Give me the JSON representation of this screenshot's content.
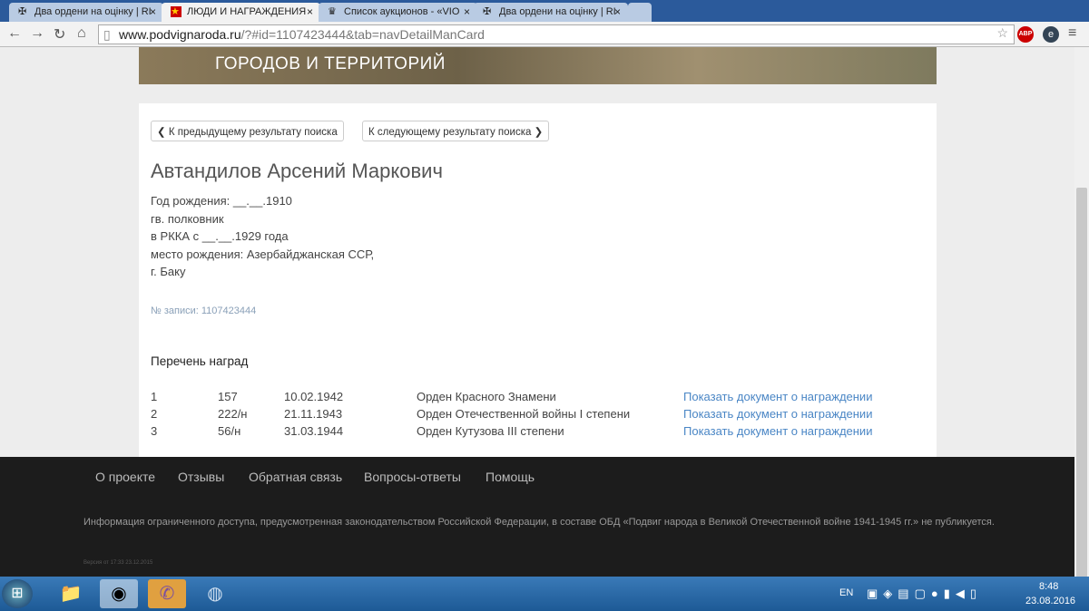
{
  "browser": {
    "tabs": [
      {
        "title": "Два ордени на оцінку | RI",
        "icon": "cross-icon",
        "active": false
      },
      {
        "title": "ЛЮДИ И НАГРАЖДЕНИЯ",
        "icon": "site-icon",
        "active": true
      },
      {
        "title": "Список аукционов - «VIO",
        "icon": "crown-icon",
        "active": false
      },
      {
        "title": "Два ордени на оцінку | RI",
        "icon": "cross-icon",
        "active": false
      }
    ],
    "url_host": "www.podvignaroda.ru",
    "url_rest": "/?#id=1107423444&tab=navDetailManCard"
  },
  "banner": {
    "text": "ГОРОДОВ И ТЕРРИТОРИЙ"
  },
  "card": {
    "prev": "К предыдущему результату поиска",
    "next": "К следующему результату поиска",
    "name": "Автандилов Арсений Маркович",
    "info": [
      "Год рождения: __.__.1910",
      "гв. полковник",
      "в РККА с __.__.1929 года",
      "место рождения: Азербайджанская ССР,",
      "г. Баку"
    ],
    "record": "№ записи: 1107423444",
    "awards_title": "Перечень наград",
    "awards": [
      {
        "n": "1",
        "num": "157",
        "date": "10.02.1942",
        "name": "Орден Красного Знамени",
        "link": "Показать документ о награждении"
      },
      {
        "n": "2",
        "num": "222/н",
        "date": "21.11.1943",
        "name": "Орден Отечественной войны I степени",
        "link": "Показать документ о награждении"
      },
      {
        "n": "3",
        "num": "56/н",
        "date": "31.03.1944",
        "name": "Орден Кутузова III степени",
        "link": "Показать документ о награждении"
      }
    ]
  },
  "footer": {
    "nav": [
      "О проекте",
      "Отзывы",
      "Обратная связь",
      "Вопросы-ответы",
      "Помощь"
    ],
    "text": "Информация ограниченного доступа, предусмотренная законодательством Российской Федерации, в составе ОБД «Подвиг народа в Великой Отечественной войне 1941-1945 гг.» не публикуется.",
    "version": "Версия от 17:33 23.12.2015"
  },
  "taskbar": {
    "lang": "EN",
    "time": "8:48",
    "date": "23.08.2016"
  }
}
